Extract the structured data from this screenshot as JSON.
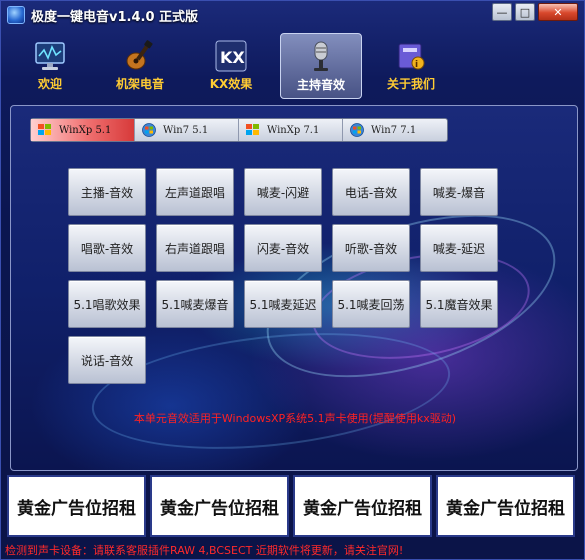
{
  "window": {
    "title": "极度一键电音v1.4.0 正式版",
    "controls": {
      "minimize": "—",
      "maximize": "□",
      "close": "✕"
    }
  },
  "nav": {
    "items": [
      {
        "label": "欢迎",
        "icon": "monitor-icon"
      },
      {
        "label": "机架电音",
        "icon": "guitar-icon"
      },
      {
        "label": "KX效果",
        "icon": "kx-icon"
      },
      {
        "label": "主持音效",
        "icon": "microphone-icon",
        "selected": true
      },
      {
        "label": "关于我们",
        "icon": "notebook-icon"
      }
    ]
  },
  "tabs": [
    {
      "label": "WinXp 5.1",
      "active": true
    },
    {
      "label": "Win7 5.1"
    },
    {
      "label": "WinXp 7.1"
    },
    {
      "label": "Win7 7.1"
    }
  ],
  "buttons": [
    "主播-音效",
    "左声道跟唱",
    "喊麦-闪避",
    "电话-音效",
    "喊麦-爆音",
    "唱歌-音效",
    "右声道跟唱",
    "闪麦-音效",
    "听歌-音效",
    "喊麦-延迟",
    "5.1唱歌效果",
    "5.1喊麦爆音",
    "5.1喊麦延迟",
    "5.1喊麦回荡",
    "5.1魔音效果",
    "说话-音效"
  ],
  "notice": "本单元音效适用于WindowsXP系统5.1声卡使用(提醒使用kx驱动)",
  "ads": [
    "黄金广告位招租",
    "黄金广告位招租",
    "黄金广告位招租",
    "黄金广告位招租"
  ],
  "status": "检测到声卡设备：请联系客服插件RAW 4,BCSECT 近期软件将更新，请关注官网!",
  "colors": {
    "nav_label": "#ffcc33",
    "notice": "#ff2222",
    "active_tab": "#e04848",
    "background": "#0b1650"
  }
}
